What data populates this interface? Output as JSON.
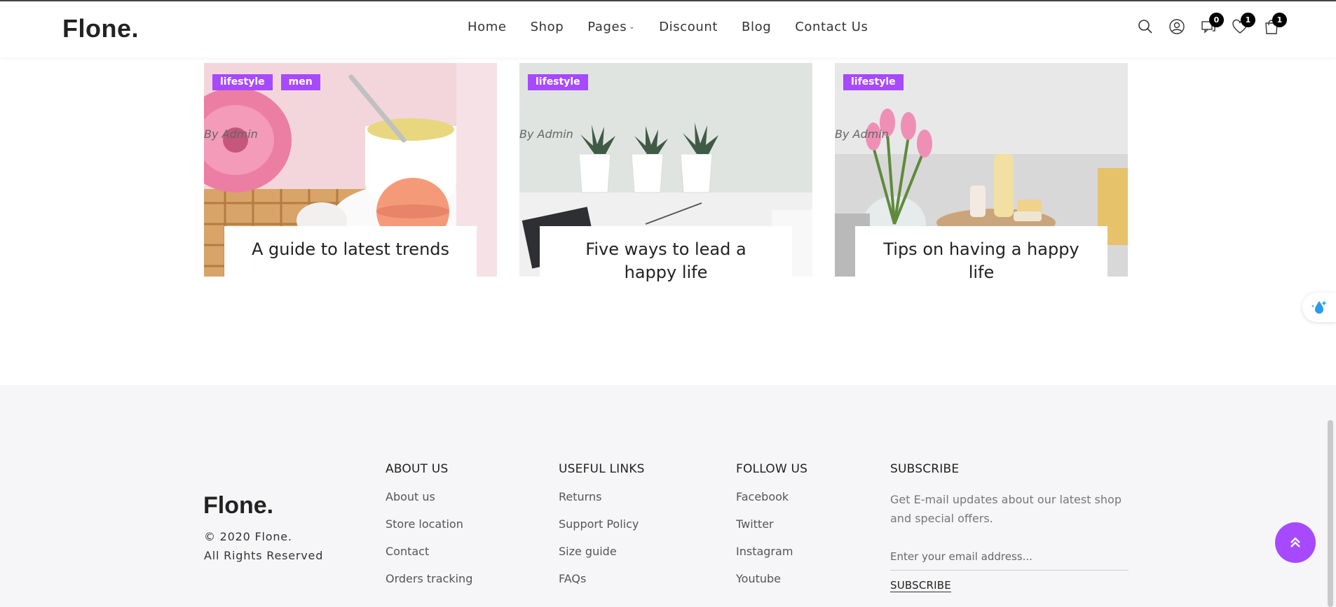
{
  "header": {
    "logo": "Flone.",
    "nav": [
      "Home",
      "Shop",
      "Pages",
      "Discount",
      "Blog",
      "Contact Us"
    ],
    "badges": {
      "compare": "0",
      "wishlist": "1",
      "cart": "1"
    }
  },
  "posts": [
    {
      "tags": [
        "lifestyle",
        "men"
      ],
      "title": "A guide to latest trends",
      "author": "By Admin"
    },
    {
      "tags": [
        "lifestyle"
      ],
      "title": "Five ways to lead a happy life",
      "author": "By Admin"
    },
    {
      "tags": [
        "lifestyle"
      ],
      "title": "Tips on having a happy life",
      "author": "By Admin"
    }
  ],
  "footer": {
    "logo": "Flone.",
    "copyright_1": "© 2020 Flone.",
    "copyright_2": "All Rights Reserved",
    "about": {
      "title": "ABOUT US",
      "links": [
        "About us",
        "Store location",
        "Contact",
        "Orders tracking"
      ]
    },
    "useful": {
      "title": "USEFUL LINKS",
      "links": [
        "Returns",
        "Support Policy",
        "Size guide",
        "FAQs"
      ]
    },
    "follow": {
      "title": "FOLLOW US",
      "links": [
        "Facebook",
        "Twitter",
        "Instagram",
        "Youtube"
      ]
    },
    "subscribe": {
      "title": "SUBSCRIBE",
      "text": "Get E-mail updates about our latest shop and special offers.",
      "placeholder": "Enter your email address...",
      "button": "SUBSCRIBE"
    }
  },
  "colors": {
    "accent": "#a749ff",
    "footer_bg": "#f6f6f8"
  }
}
